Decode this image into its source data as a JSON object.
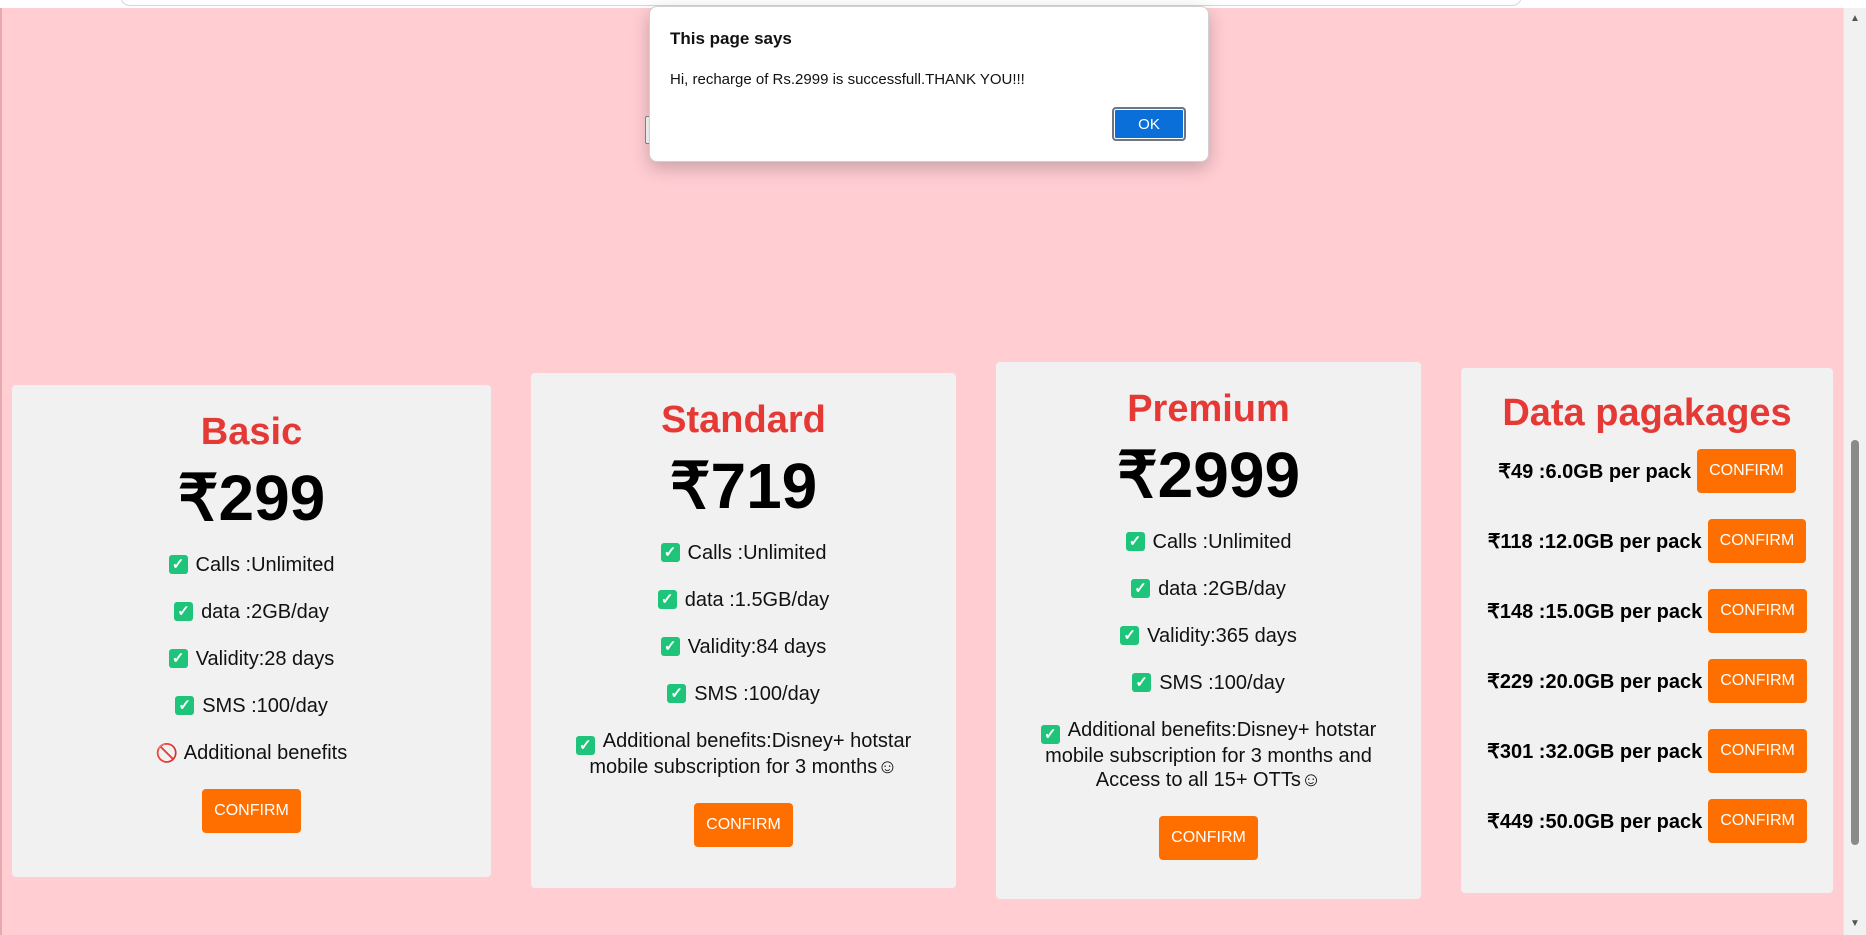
{
  "dialog": {
    "title": "This page says",
    "message": "Hi, recharge of Rs.2999 is successfull.THANK YOU!!!",
    "ok_label": "OK"
  },
  "plans": [
    {
      "name": "Basic",
      "price": "₹299",
      "features": [
        {
          "text": "Calls :Unlimited",
          "icon": "check-icon"
        },
        {
          "text": "data :2GB/day",
          "icon": "check-icon"
        },
        {
          "text": "Validity:28 days",
          "icon": "check-icon"
        },
        {
          "text": "SMS :100/day",
          "icon": "check-icon"
        },
        {
          "text": "Additional benefits",
          "icon": "prohibited-icon"
        }
      ],
      "confirm_label": "CONFIRM"
    },
    {
      "name": "Standard",
      "price": "₹719",
      "features": [
        {
          "text": "Calls :Unlimited",
          "icon": "check-icon"
        },
        {
          "text": "data :1.5GB/day",
          "icon": "check-icon"
        },
        {
          "text": "Validity:84 days",
          "icon": "check-icon"
        },
        {
          "text": "SMS :100/day",
          "icon": "check-icon"
        },
        {
          "text": "Additional benefits:Disney+ hotstar mobile subscription for 3 months☺",
          "icon": "check-icon"
        }
      ],
      "confirm_label": "CONFIRM"
    },
    {
      "name": "Premium",
      "price": "₹2999",
      "features": [
        {
          "text": "Calls :Unlimited",
          "icon": "check-icon"
        },
        {
          "text": "data :2GB/day",
          "icon": "check-icon"
        },
        {
          "text": "Validity:365 days",
          "icon": "check-icon"
        },
        {
          "text": "SMS :100/day",
          "icon": "check-icon"
        },
        {
          "text": "Additional benefits:Disney+ hotstar mobile subscription for 3 months and Access to all 15+ OTTs☺",
          "icon": "check-icon"
        }
      ],
      "confirm_label": "CONFIRM"
    }
  ],
  "data_packages": {
    "title": "Data pagakages",
    "items": [
      {
        "label": "₹49 :6.0GB per pack",
        "confirm_label": "CONFIRM"
      },
      {
        "label": "₹118 :12.0GB per pack",
        "confirm_label": "CONFIRM"
      },
      {
        "label": "₹148 :15.0GB per pack",
        "confirm_label": "CONFIRM"
      },
      {
        "label": "₹229 :20.0GB per pack",
        "confirm_label": "CONFIRM"
      },
      {
        "label": "₹301 :32.0GB per pack",
        "confirm_label": "CONFIRM"
      },
      {
        "label": "₹449 :50.0GB per pack",
        "confirm_label": "CONFIRM"
      }
    ]
  },
  "colors": {
    "page_background": "#ffcdd2",
    "card_background": "#f1f1f1",
    "heading": "#e53935",
    "confirm_button": "#ff6f00",
    "check": "#1ec47a",
    "dialog_ok": "#0a6fd8"
  }
}
